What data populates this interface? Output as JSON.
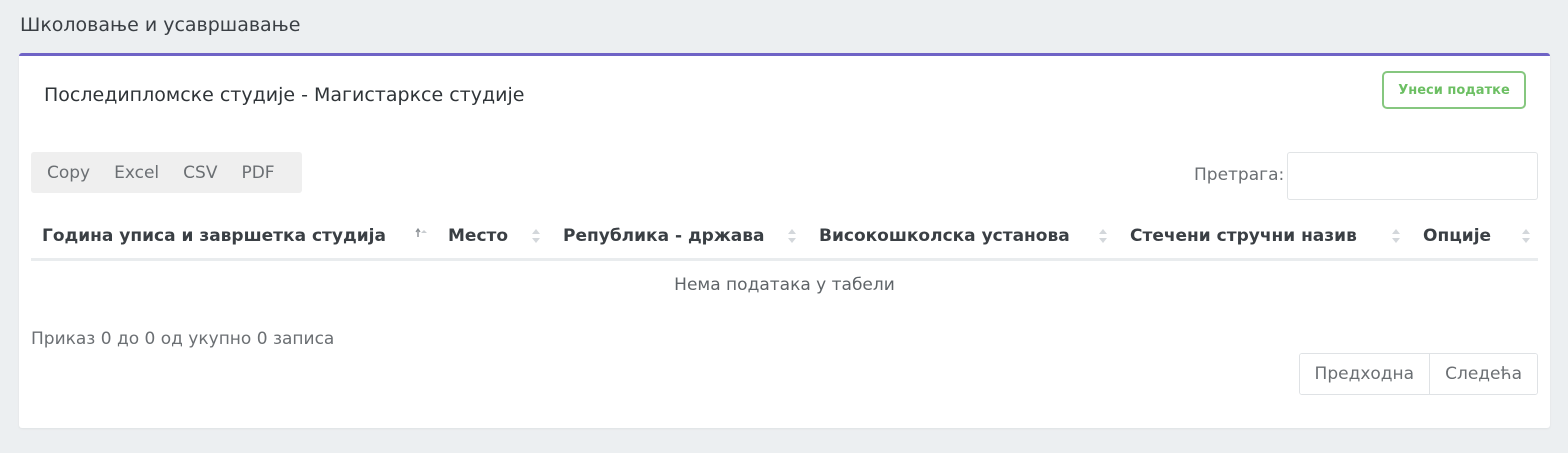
{
  "page": {
    "title": "Школовање и усавршавање"
  },
  "card": {
    "title": "Последипломске студије - Магистарксе студије",
    "add_button": "Унеси податке",
    "accent_color": "#6f63c6",
    "button_color": "#6cbf63"
  },
  "toolbar": {
    "export_buttons": [
      "Copy",
      "Excel",
      "CSV",
      "PDF"
    ],
    "search_label": "Претрага:",
    "search_value": ""
  },
  "table": {
    "columns": [
      {
        "label": "Година уписа и завршетка студија",
        "sort": "ascending"
      },
      {
        "label": "Место",
        "sort": "none"
      },
      {
        "label": "Република - држава",
        "sort": "none"
      },
      {
        "label": "Високошколска установа",
        "sort": "none"
      },
      {
        "label": "Стечени стручни назив",
        "sort": "none"
      },
      {
        "label": "Опције",
        "sort": "none"
      }
    ],
    "empty_message": "Нема података у табели",
    "rows": []
  },
  "footer": {
    "info": "Приказ 0 до 0 од укупно 0 записа",
    "prev": "Предходна",
    "next": "Следећа"
  }
}
